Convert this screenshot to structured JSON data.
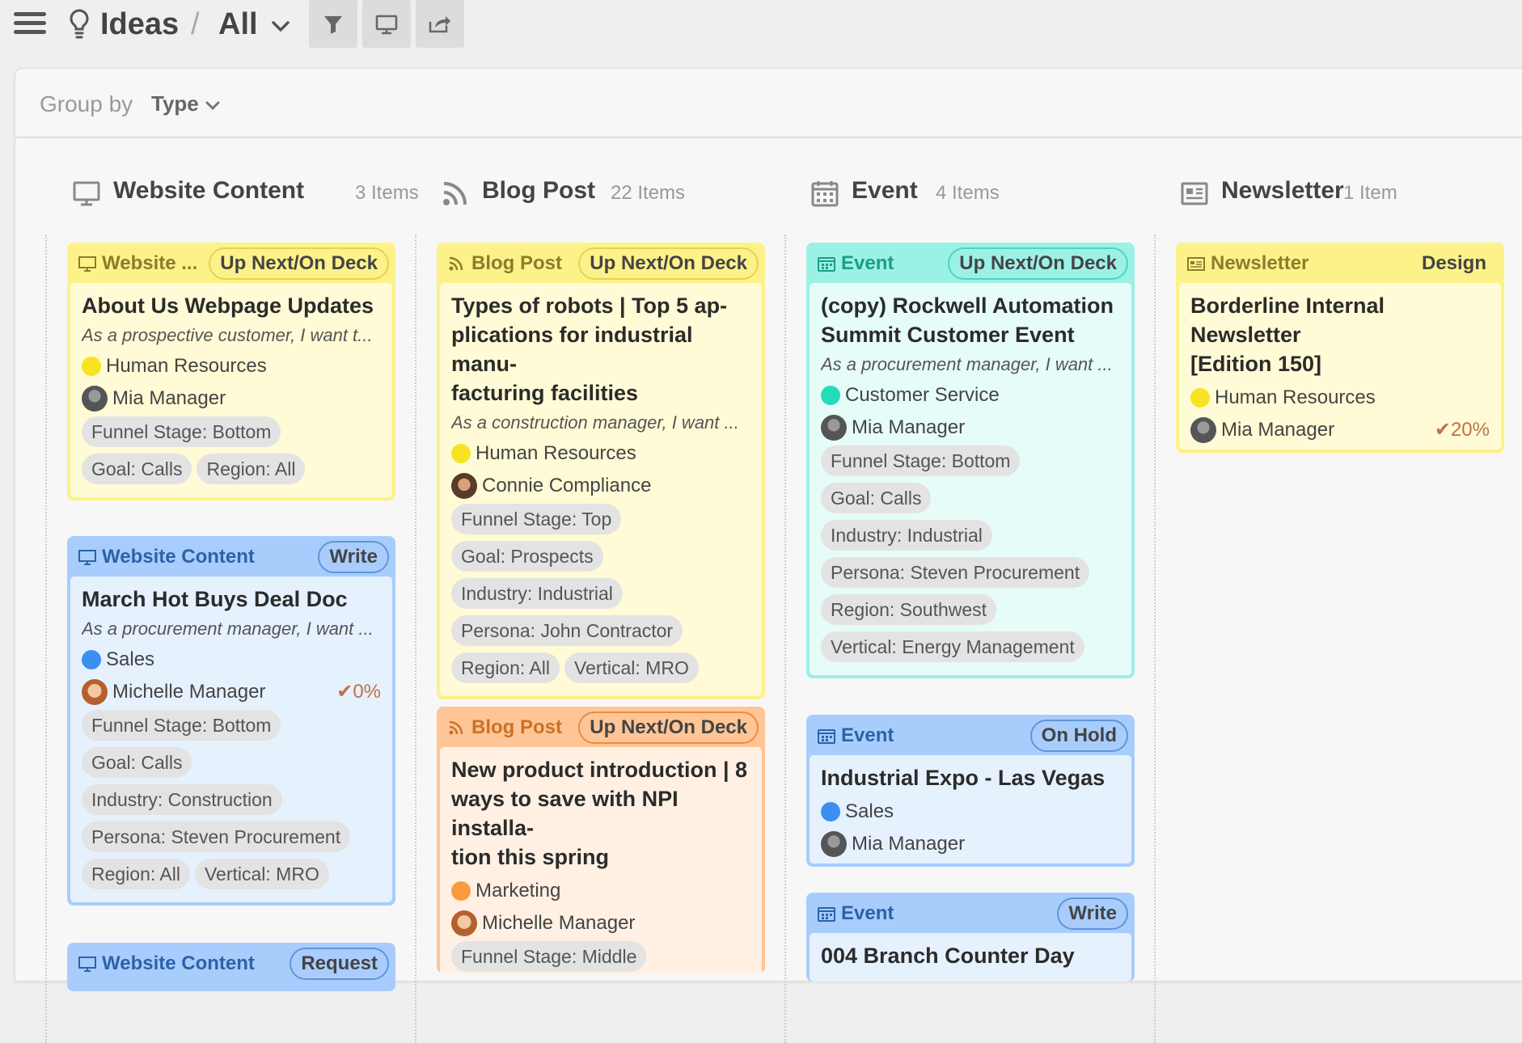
{
  "header": {
    "title": "Ideas",
    "view": "All",
    "separator": "/"
  },
  "groupby": {
    "label": "Group by",
    "value": "Type"
  },
  "columns": [
    {
      "name": "Website Content",
      "count": "3 Items"
    },
    {
      "name": "Blog Post",
      "count": "22 Items"
    },
    {
      "name": "Event",
      "count": "4 Items"
    },
    {
      "name": "Newsletter",
      "count": "1 Item"
    }
  ],
  "cards": {
    "wc1": {
      "type": "Website ...",
      "status": "Up Next/On Deck",
      "title": "About Us Webpage Updates",
      "desc": "As a prospective customer, I want t...",
      "dept": "Human Resources",
      "owner": "Mia Manager",
      "tags": [
        "Funnel Stage: Bottom",
        "Goal: Calls",
        "Region: All"
      ]
    },
    "wc2": {
      "type": "Website Content",
      "status": "Write",
      "title": "March Hot Buys Deal Doc",
      "desc": "As a procurement manager, I want ...",
      "dept": "Sales",
      "owner": "Michelle Manager",
      "progress": "0%",
      "tags": [
        "Funnel Stage: Bottom",
        "Goal: Calls",
        "Industry: Construction",
        "Persona: Steven Procurement",
        "Region: All",
        "Vertical: MRO"
      ]
    },
    "wc3": {
      "type": "Website Content",
      "status": "Request"
    },
    "bp1": {
      "type": "Blog Post",
      "status": "Up Next/On Deck",
      "title_lines": [
        "Types of robots | Top 5 ap-",
        "plications for industrial manu-",
        "facturing facilities"
      ],
      "desc": "As a construction manager, I want ...",
      "dept": "Human Resources",
      "owner": "Connie Compliance",
      "tags": [
        "Funnel Stage: Top",
        "Goal: Prospects",
        "Industry: Industrial",
        "Persona: John Contractor",
        "Region: All",
        "Vertical: MRO"
      ]
    },
    "bp2": {
      "type": "Blog Post",
      "status": "Up Next/On Deck",
      "title_lines": [
        "New product introduction | 8",
        "ways to save with NPI installa-",
        "tion this spring"
      ],
      "dept": "Marketing",
      "owner": "Michelle Manager",
      "tags": [
        "Funnel Stage: Middle"
      ]
    },
    "ev1": {
      "type": "Event",
      "status": "Up Next/On Deck",
      "title_lines": [
        "(copy) Rockwell Automation",
        "Summit Customer Event"
      ],
      "desc": "As a procurement manager, I want ...",
      "dept": "Customer Service",
      "owner": "Mia Manager",
      "tags": [
        "Funnel Stage: Bottom",
        "Goal: Calls",
        "Industry: Industrial",
        "Persona: Steven Procurement",
        "Region: Southwest",
        "Vertical: Energy Management"
      ]
    },
    "ev2": {
      "type": "Event",
      "status": "On Hold",
      "title": "Industrial Expo - Las Vegas",
      "dept": "Sales",
      "owner": "Mia Manager"
    },
    "ev3": {
      "type": "Event",
      "status": "Write",
      "title": "004 Branch Counter Day"
    },
    "nl1": {
      "type": "Newsletter",
      "status": "Design",
      "title_lines": [
        "Borderline Internal Newsletter",
        "[Edition 150]"
      ],
      "dept": "Human Resources",
      "owner": "Mia Manager",
      "progress": "20%"
    }
  },
  "colors": {
    "yellow": "#fdf28a",
    "blue": "#a8cdfd",
    "teal": "#9cf1e6",
    "orange": "#ffc596",
    "dot_yellow": "#f7e321",
    "dot_blue": "#3b8ff0",
    "dot_teal": "#25dcb7",
    "dot_orange": "#fb9a3b"
  },
  "icons": {
    "menu": "hamburger-icon",
    "bulb": "lightbulb-icon",
    "filter": "filter-icon",
    "present": "monitor-icon",
    "share": "share-icon"
  }
}
